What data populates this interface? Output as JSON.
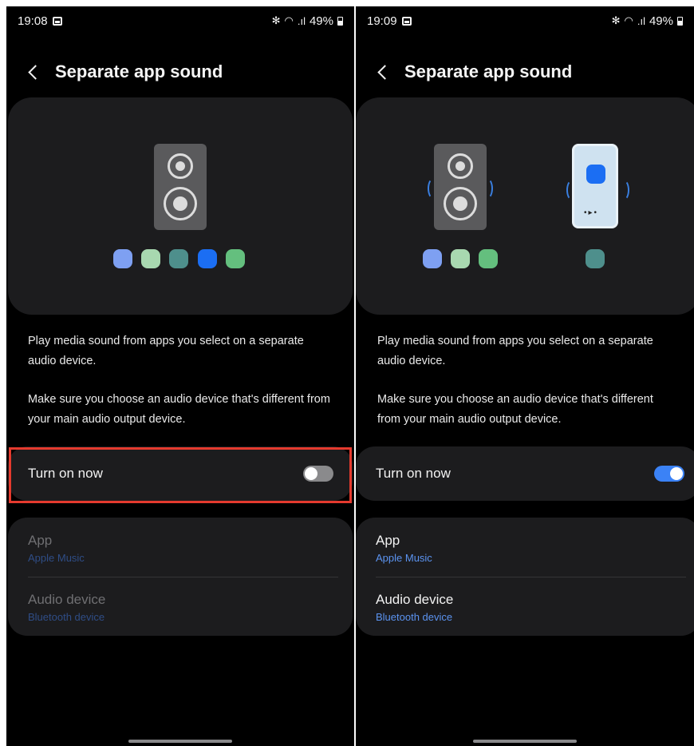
{
  "screens": [
    {
      "status": {
        "time": "19:08",
        "battery": "49%"
      },
      "title": "Separate app sound",
      "description": [
        "Play media sound from apps you select on a separate audio device.",
        "Make sure you choose an audio device that's different from your main audio output device."
      ],
      "toggle": {
        "label": "Turn on now",
        "state": "off"
      },
      "list": [
        {
          "title": "App",
          "value": "Apple Music"
        },
        {
          "title": "Audio device",
          "value": "Bluetooth device"
        }
      ]
    },
    {
      "status": {
        "time": "19:09",
        "battery": "49%"
      },
      "title": "Separate app sound",
      "description": [
        "Play media sound from apps you select on a separate audio device.",
        "Make sure you choose an audio device that's different from your main audio output device."
      ],
      "toggle": {
        "label": "Turn on now",
        "state": "on"
      },
      "list": [
        {
          "title": "App",
          "value": "Apple Music"
        },
        {
          "title": "Audio device",
          "value": "Bluetooth device"
        }
      ]
    }
  ],
  "icons": {
    "status_left": "gallery-icon",
    "status_right": [
      "bluetooth-icon",
      "wifi-icon",
      "signal-icon",
      "battery-icon"
    ],
    "back": "back-arrow-icon"
  },
  "colors": {
    "background": "#000000",
    "card": "#1c1c1e",
    "accent": "#3b82f6",
    "highlight": "#e53a2e",
    "app_dots": [
      "#7ea0f2",
      "#a8d8b0",
      "#4e8f8c",
      "#1b6ef3",
      "#64bf7e"
    ]
  }
}
